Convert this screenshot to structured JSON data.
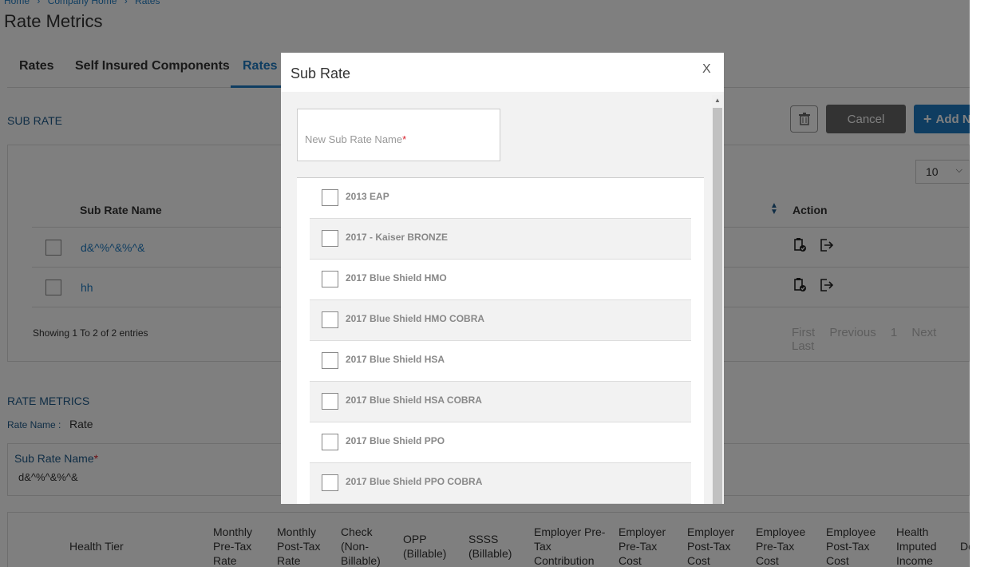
{
  "breadcrumb": [
    "Home",
    "Company Home",
    "Rates"
  ],
  "page_title": "Rate Metrics",
  "tabs": [
    {
      "label": "Rates"
    },
    {
      "label": "Self Insured Components"
    },
    {
      "label": "Rates N"
    }
  ],
  "sub_rate_section": {
    "title": "SUB RATE",
    "cancel_label": "Cancel",
    "add_label": "Add N",
    "add_icon": "+",
    "page_size": "10",
    "columns": {
      "name": "Sub Rate Name",
      "action": "Action"
    },
    "rows": [
      {
        "name": "d&^%^&%^&"
      },
      {
        "name": "hh"
      }
    ],
    "entries_text": "Showing 1 To 2 of 2 entries",
    "pager": {
      "first": "First",
      "previous": "Previous",
      "page": "1",
      "next": "Next",
      "last": "Last"
    }
  },
  "rate_metrics": {
    "title": "RATE METRICS",
    "rate_name_label": "Rate Name :",
    "rate_name_value": "Rate",
    "sub_rate_name_label": "Sub Rate Name",
    "sub_rate_name_value": "d&^%^&%^&",
    "required_mark": "*",
    "columns": [
      "Health Tier",
      "Monthly Pre-Tax Rate",
      "Monthly Post-Tax Rate",
      "Check (Non-Billable)",
      "OPP (Billable)",
      "SSSS (Billable)",
      "Employer Pre-Tax Contribution",
      "Employer Pre-Tax Cost",
      "Employer Post-Tax Cost",
      "Employee Pre-Tax Cost",
      "Employee Post-Tax Cost",
      "Health Imputed Income",
      "De"
    ]
  },
  "modal": {
    "title": "Sub Rate",
    "close_label": "X",
    "name_placeholder": "New Sub Rate Name",
    "required_mark": "*",
    "items": [
      {
        "label": "2013 EAP"
      },
      {
        "label": "2017 - Kaiser BRONZE"
      },
      {
        "label": "2017 Blue Shield HMO"
      },
      {
        "label": "2017 Blue Shield HMO COBRA"
      },
      {
        "label": "2017 Blue Shield HSA"
      },
      {
        "label": "2017 Blue Shield HSA COBRA"
      },
      {
        "label": "2017 Blue Shield PPO"
      },
      {
        "label": "2017 Blue Shield PPO COBRA"
      }
    ]
  },
  "colors": {
    "accent": "#1e7bc2",
    "required": "#d9232e",
    "cancel_button": "#666666"
  },
  "icons": {
    "trash": "trash-icon",
    "close": "close-icon",
    "sort": "sort-icon",
    "copy": "copy-icon",
    "export": "export-icon"
  }
}
